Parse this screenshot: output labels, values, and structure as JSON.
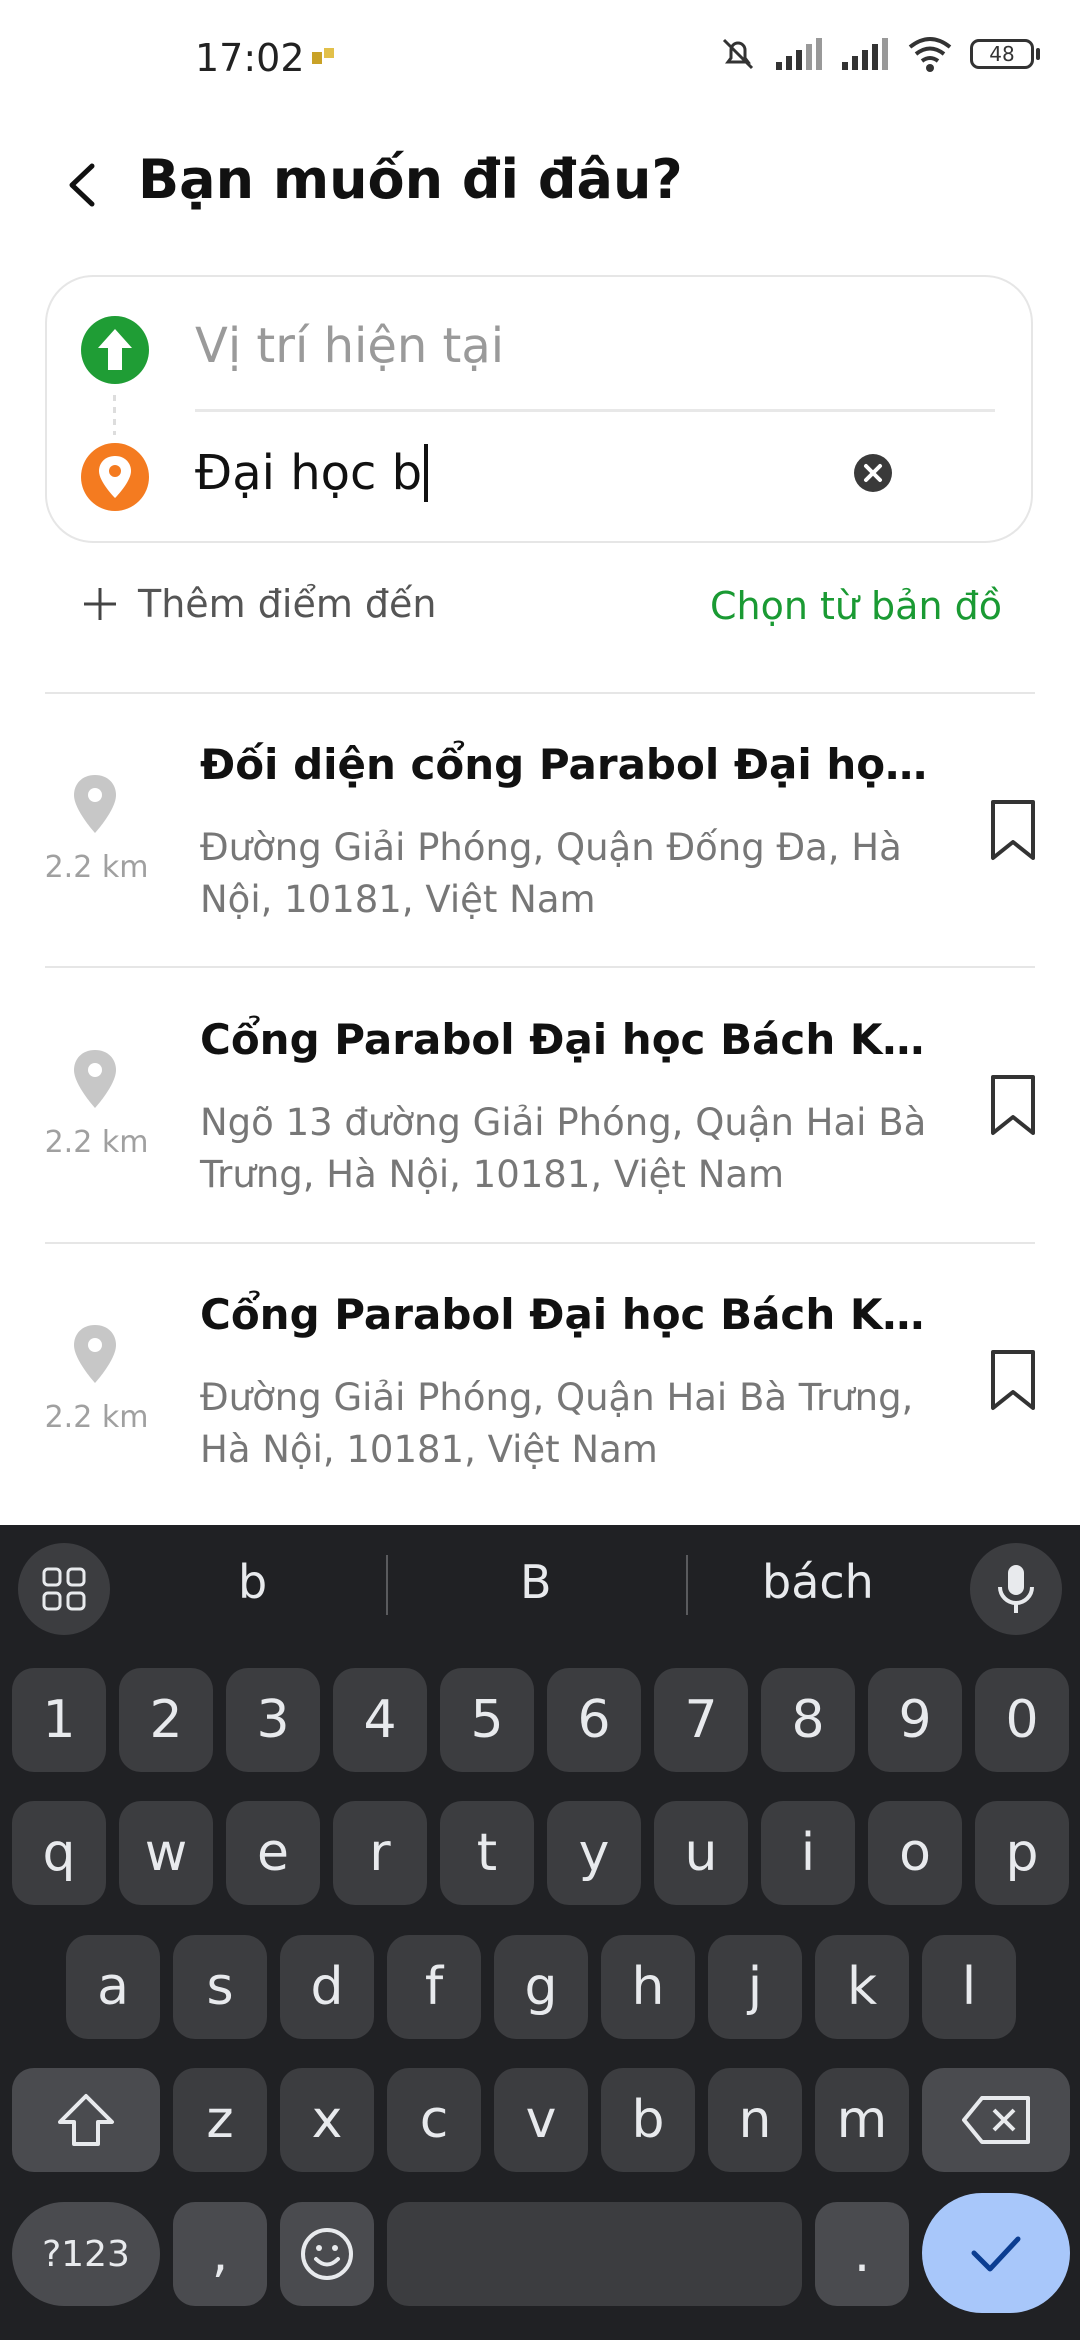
{
  "status_bar": {
    "time": "17:02",
    "battery": "48"
  },
  "header": {
    "title": "Bạn muốn đi đâu?"
  },
  "route": {
    "from_placeholder": "Vị trí hiện tại",
    "to_value": "Đại học b"
  },
  "actions": {
    "add_stop": "Thêm điểm đến",
    "pick_on_map": "Chọn từ bản đồ"
  },
  "results": [
    {
      "title": "Đối diện cổng Parabol Đại học B...",
      "address": "Đường Giải Phóng, Quận Đống Đa, Hà Nội, 10181, Việt Nam",
      "distance": "2.2 km"
    },
    {
      "title": "Cổng Parabol Đại học Bách Kho...",
      "address": "Ngõ 13 đường Giải Phóng, Quận Hai Bà Trưng, Hà Nội, 10181, Việt Nam",
      "distance": "2.2 km"
    },
    {
      "title": "Cổng Parabol Đại học Bách Kho...",
      "address": "Đường Giải Phóng, Quận Hai Bà Trưng, Hà Nội, 10181, Việt Nam",
      "distance": "2.2 km"
    }
  ],
  "keyboard": {
    "suggestions": [
      "b",
      "B",
      "bách"
    ],
    "row_numbers": [
      "1",
      "2",
      "3",
      "4",
      "5",
      "6",
      "7",
      "8",
      "9",
      "0"
    ],
    "row1": [
      "q",
      "w",
      "e",
      "r",
      "t",
      "y",
      "u",
      "i",
      "o",
      "p"
    ],
    "row2": [
      "a",
      "s",
      "d",
      "f",
      "g",
      "h",
      "j",
      "k",
      "l"
    ],
    "row3": [
      "z",
      "x",
      "c",
      "v",
      "b",
      "n",
      "m"
    ],
    "symbols_label": "?123",
    "comma": ",",
    "period": "."
  },
  "colors": {
    "accent_green": "#1a9a33",
    "start_pin": "#1f9d35",
    "dest_pin": "#f47b20",
    "keyboard_bg": "#202124",
    "enter_key": "#a8c7fa"
  },
  "icons": {
    "back": "arrow-left-icon",
    "start": "up-arrow-circle-icon",
    "destination": "location-pin-icon",
    "clear": "close-circle-icon",
    "add": "plus-icon",
    "bookmark": "bookmark-icon",
    "mic": "microphone-icon",
    "shift": "shift-icon",
    "backspace": "backspace-icon",
    "emoji": "emoji-icon",
    "enter": "check-icon"
  }
}
